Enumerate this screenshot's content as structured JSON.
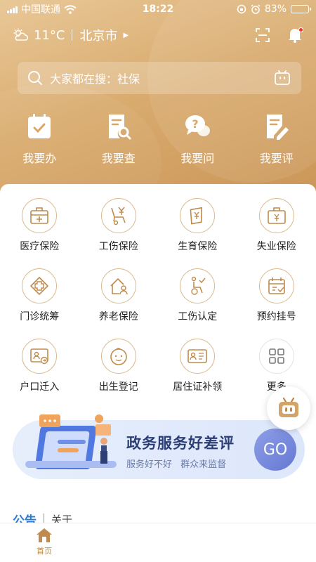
{
  "status_bar": {
    "carrier": "中国联通",
    "time": "18:22",
    "battery": "83%",
    "battery_level": 0.83
  },
  "header": {
    "temperature": "11°C",
    "city": "北京市"
  },
  "search": {
    "placeholder": "大家都在搜：社保"
  },
  "quick_actions": [
    {
      "label": "我要办",
      "icon": "calendar-check-icon"
    },
    {
      "label": "我要查",
      "icon": "document-search-icon"
    },
    {
      "label": "我要问",
      "icon": "question-chat-icon"
    },
    {
      "label": "我要评",
      "icon": "document-edit-icon"
    }
  ],
  "services": [
    {
      "label": "医疗保险",
      "icon": "medical-box-icon"
    },
    {
      "label": "工伤保险",
      "icon": "wheelchair-yen-icon"
    },
    {
      "label": "生育保险",
      "icon": "yen-leaf-icon"
    },
    {
      "label": "失业保险",
      "icon": "briefcase-yen-icon"
    },
    {
      "label": "门诊统筹",
      "icon": "cross-badge-icon"
    },
    {
      "label": "养老保险",
      "icon": "house-person-icon"
    },
    {
      "label": "工伤认定",
      "icon": "wheelchair-check-icon"
    },
    {
      "label": "预约挂号",
      "icon": "calendar-booking-icon"
    },
    {
      "label": "户口迁入",
      "icon": "id-card-transfer-icon"
    },
    {
      "label": "出生登记",
      "icon": "baby-face-icon"
    },
    {
      "label": "居住证补领",
      "icon": "id-card-reissue-icon"
    },
    {
      "label": "更多",
      "icon": "grid-more-icon"
    }
  ],
  "banner": {
    "title": "政务服务好差评",
    "subtitle": "服务好不好  群众来监督",
    "button": "GO"
  },
  "notice": {
    "tag": "公告",
    "text": "关于"
  },
  "tabbar": {
    "home_label": "首页"
  },
  "colors": {
    "accent": "#c08a4c",
    "header_gradient_start": "#e9c898",
    "header_gradient_end": "#c99556",
    "banner_title": "#2d3e75",
    "notice_tag": "#2a7bd8"
  }
}
